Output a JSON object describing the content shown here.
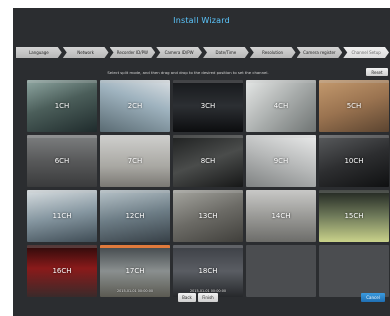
{
  "window": {
    "title": "Install Wizard"
  },
  "steps": [
    {
      "label": "Language",
      "active": false
    },
    {
      "label": "Network",
      "active": false
    },
    {
      "label": "Recorder ID/PW",
      "active": false
    },
    {
      "label": "Camera ID/PW",
      "active": false
    },
    {
      "label": "Date/Time",
      "active": false
    },
    {
      "label": "Resolution",
      "active": false
    },
    {
      "label": "Camera register",
      "active": false
    },
    {
      "label": "Channel Setup",
      "active": true
    }
  ],
  "instruction": "Select split mode, and then drag and drop to the desired position to set the channel.",
  "reset_label": "Reset",
  "channels": [
    {
      "label": "1CH",
      "scene": "s1",
      "timestamp": "",
      "selected": false
    },
    {
      "label": "2CH",
      "scene": "s2",
      "timestamp": "",
      "selected": false
    },
    {
      "label": "3CH",
      "scene": "s3",
      "timestamp": "",
      "selected": false
    },
    {
      "label": "4CH",
      "scene": "s4",
      "timestamp": "",
      "selected": false
    },
    {
      "label": "5CH",
      "scene": "s5",
      "timestamp": "",
      "selected": false
    },
    {
      "label": "6CH",
      "scene": "s6",
      "timestamp": "",
      "selected": false
    },
    {
      "label": "7CH",
      "scene": "s7",
      "timestamp": "",
      "selected": false
    },
    {
      "label": "8CH",
      "scene": "s8",
      "timestamp": "",
      "selected": false
    },
    {
      "label": "9CH",
      "scene": "s9",
      "timestamp": "",
      "selected": false
    },
    {
      "label": "10CH",
      "scene": "s10",
      "timestamp": "",
      "selected": false
    },
    {
      "label": "11CH",
      "scene": "s11",
      "timestamp": "",
      "selected": false
    },
    {
      "label": "12CH",
      "scene": "s12",
      "timestamp": "",
      "selected": false
    },
    {
      "label": "13CH",
      "scene": "s13",
      "timestamp": "",
      "selected": false
    },
    {
      "label": "14CH",
      "scene": "s14",
      "timestamp": "",
      "selected": false
    },
    {
      "label": "15CH",
      "scene": "s15",
      "timestamp": "",
      "selected": false
    },
    {
      "label": "16CH",
      "scene": "s16",
      "timestamp": "",
      "selected": false
    },
    {
      "label": "17CH",
      "scene": "s17",
      "timestamp": "2015-01-01 00:00:00",
      "selected": true
    },
    {
      "label": "18CH",
      "scene": "s18",
      "timestamp": "2015-01-01 00:00:00",
      "selected": false
    },
    {
      "label": "",
      "scene": "empty",
      "timestamp": "",
      "selected": false
    },
    {
      "label": "",
      "scene": "empty",
      "timestamp": "",
      "selected": false
    }
  ],
  "buttons": {
    "back": "Back",
    "finish": "Finish",
    "cancel": "Cancel"
  },
  "colors": {
    "title": "#5cc8ff",
    "accent": "#e07a3c",
    "cancel": "#1f6fb3",
    "window_bg": "#2b2d30"
  }
}
